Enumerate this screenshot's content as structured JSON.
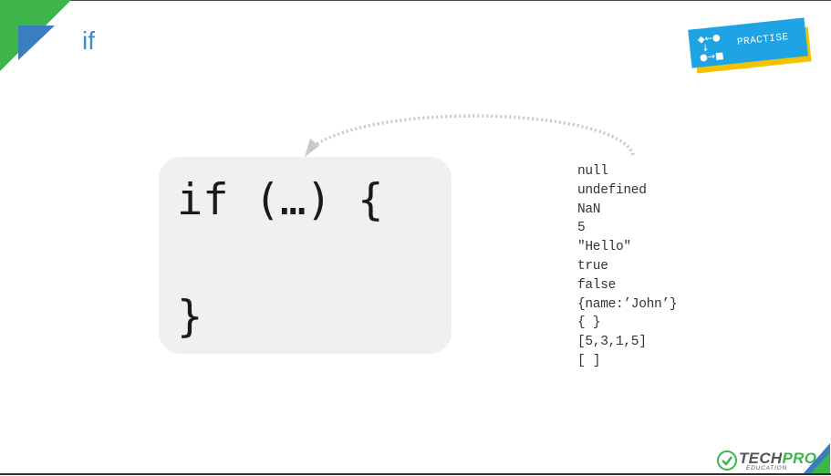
{
  "slide": {
    "title": "if"
  },
  "badge": {
    "label": "PRACTISE",
    "glyph": "◆←●\n↓\n●→■"
  },
  "code": {
    "line1": "if (…) {",
    "line2": "}"
  },
  "values": [
    "null",
    "undefined",
    "NaN",
    "5",
    "\"Hello\"",
    "true",
    "false",
    "{name:’John’}",
    "{ }",
    "[5,3,1,5]",
    "[ ]"
  ],
  "logo": {
    "brand_part1": "TECH",
    "brand_part2": "PRO",
    "subtitle": "EDUCATION"
  },
  "colors": {
    "title": "#3a8fbf",
    "badge_blue": "#1ea3e4",
    "badge_yellow": "#f2c300",
    "corner_green": "#3db54a",
    "corner_blue": "#3b7ec0",
    "code_box": "#f0f0f0"
  }
}
